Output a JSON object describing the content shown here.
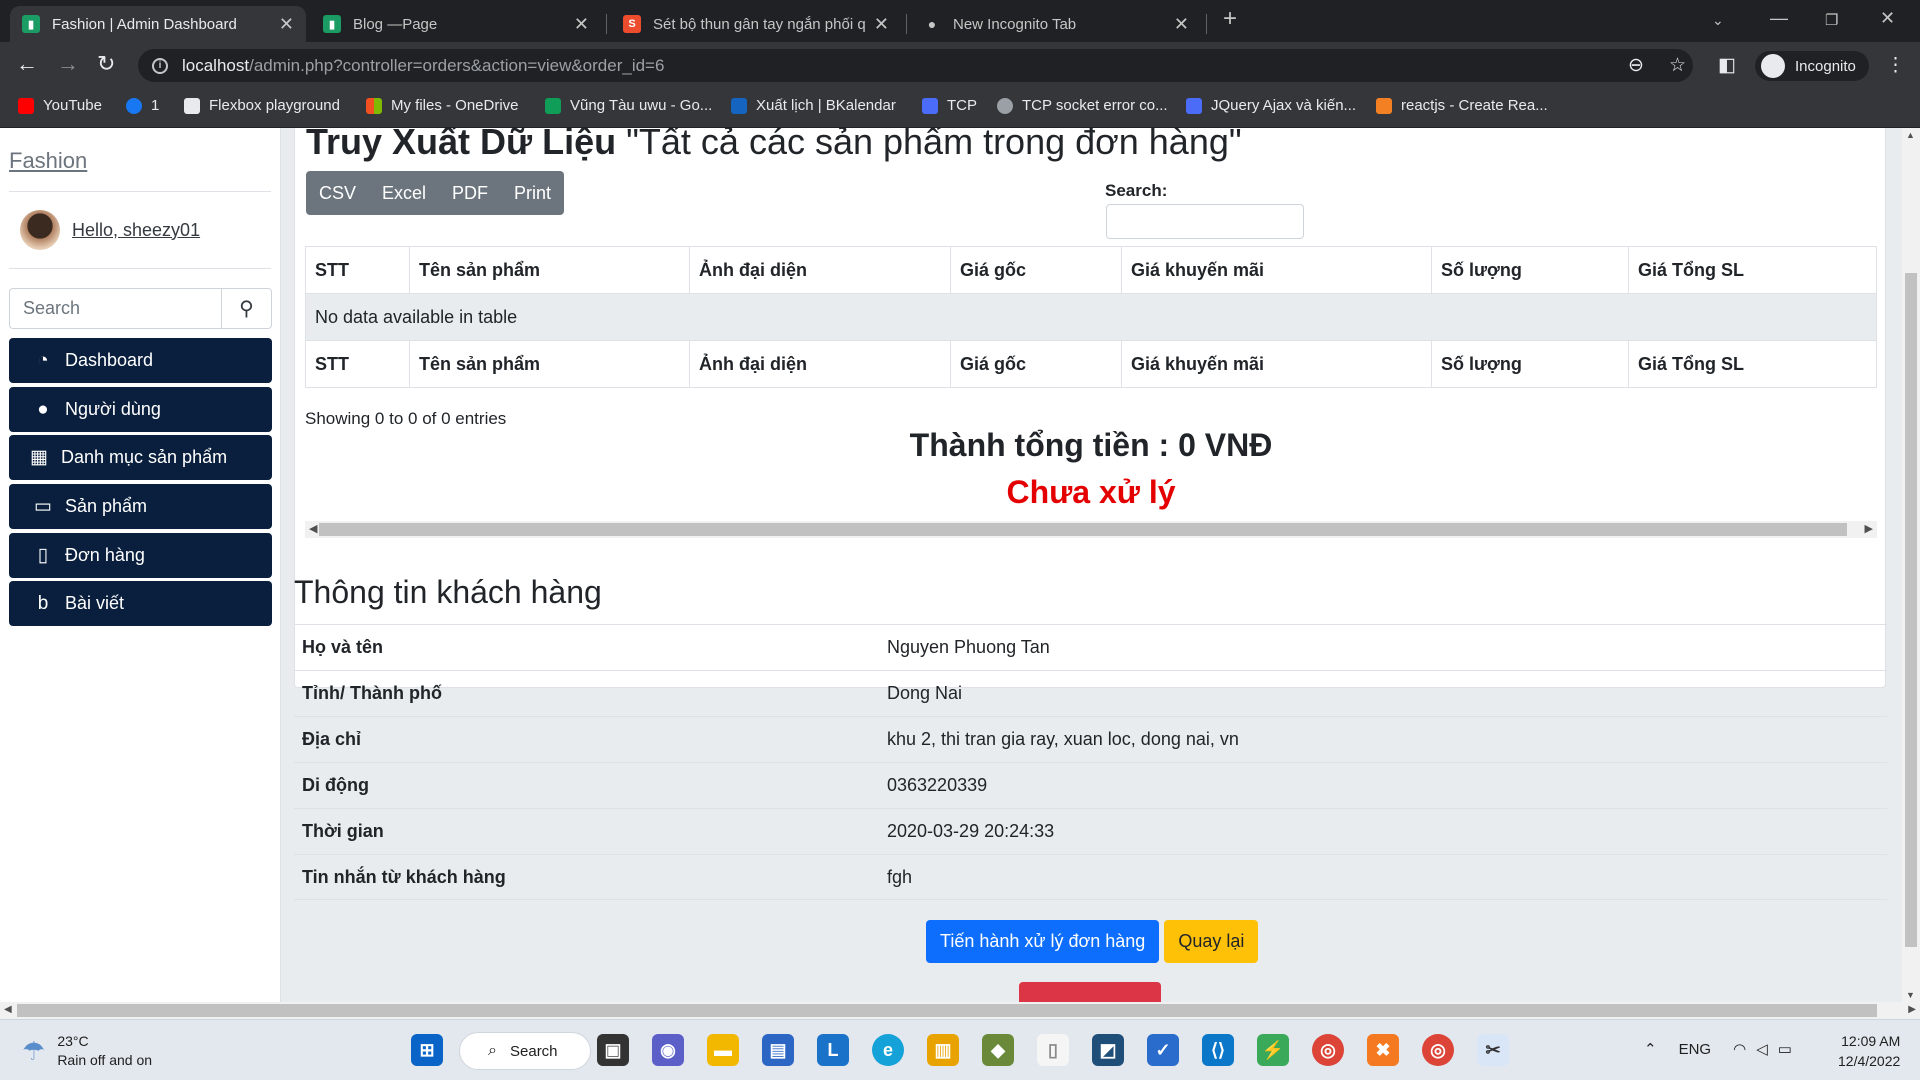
{
  "browser": {
    "tabs": [
      {
        "title": "Fashion | Admin Dashboard",
        "active": true,
        "favicon_color": "#1a9c64"
      },
      {
        "title": "Blog —Page",
        "active": false,
        "favicon_color": "#1a9c64"
      },
      {
        "title": "Sét bộ thun gân tay ngắn phối q",
        "active": false,
        "favicon_color": "#ee4d2d"
      },
      {
        "title": "New Incognito Tab",
        "active": false,
        "favicon_color": "#9aa0a6"
      }
    ],
    "url_host": "localhost",
    "url_path": "/admin.php?controller=orders&action=view&order_id=6",
    "profile": "Incognito",
    "bookmarks": [
      {
        "label": "YouTube",
        "icon_color": "#ff0000"
      },
      {
        "label": "1",
        "icon_color": "#1877f2"
      },
      {
        "label": "Flexbox playground",
        "icon_color": "#e8eaed"
      },
      {
        "label": "My files - OneDrive",
        "icon_color": "#f25022"
      },
      {
        "label": "Vũng Tàu uwu - Go...",
        "icon_color": "#0f9d58"
      },
      {
        "label": "Xuất lịch | BKalendar",
        "icon_color": "#1565c0"
      },
      {
        "label": "TCP",
        "icon_color": "#4a6cf7"
      },
      {
        "label": "TCP socket error co...",
        "icon_color": "#9aa0a6"
      },
      {
        "label": "JQuery Ajax và kiến...",
        "icon_color": "#4a6cf7"
      },
      {
        "label": "reactjs - Create Rea...",
        "icon_color": "#f48024"
      }
    ]
  },
  "sidebar": {
    "brand": "Fashion",
    "greeting": "Hello, sheezy01",
    "search_placeholder": "Search",
    "items": [
      {
        "label": "Dashboard",
        "icon": "dashboard-icon"
      },
      {
        "label": "Người dùng",
        "icon": "user-icon"
      },
      {
        "label": "Danh mục sản phẩm",
        "icon": "grid-icon"
      },
      {
        "label": "Sản phẩm",
        "icon": "monitor-icon"
      },
      {
        "label": "Đơn hàng",
        "icon": "document-icon"
      },
      {
        "label": "Bài viết",
        "icon": "blog-icon"
      }
    ]
  },
  "main": {
    "title_bold": "Truy Xuất Dữ Liệu",
    "title_quote": " \"Tất cả các sản phẩm trong đơn hàng\"",
    "export_buttons": [
      "CSV",
      "Excel",
      "PDF",
      "Print"
    ],
    "search_label": "Search:",
    "columns": [
      "STT",
      "Tên sản phẩm",
      "Ảnh đại diện",
      "Giá gốc",
      "Giá khuyến mãi",
      "Số lượng",
      "Giá Tổng SL"
    ],
    "empty_message": "No data available in table",
    "showing": "Showing 0 to 0 of 0 entries",
    "total": "Thành tổng tiền : 0 VNĐ",
    "status": "Chưa xử lý",
    "status_color": "#e40000"
  },
  "customer": {
    "title": "Thông tin khách hàng",
    "rows": [
      {
        "label": "Họ và tên",
        "value": "Nguyen Phuong Tan"
      },
      {
        "label": "Tỉnh/ Thành phố",
        "value": "Dong Nai"
      },
      {
        "label": "Địa chỉ",
        "value": "khu 2, thi tran gia ray, xuan loc, dong nai, vn"
      },
      {
        "label": "Di động",
        "value": "0363220339"
      },
      {
        "label": "Thời gian",
        "value": "2020-03-29 20:24:33"
      },
      {
        "label": "Tin nhắn từ khách hàng",
        "value": "fgh"
      }
    ],
    "process_button": "Tiến hành xử lý đơn hàng",
    "back_button": "Quay lại"
  },
  "taskbar": {
    "temperature": "23°C",
    "weather": "Rain off and on",
    "search": "Search",
    "language": "ENG",
    "time": "12:09 AM",
    "date": "12/4/2022"
  }
}
